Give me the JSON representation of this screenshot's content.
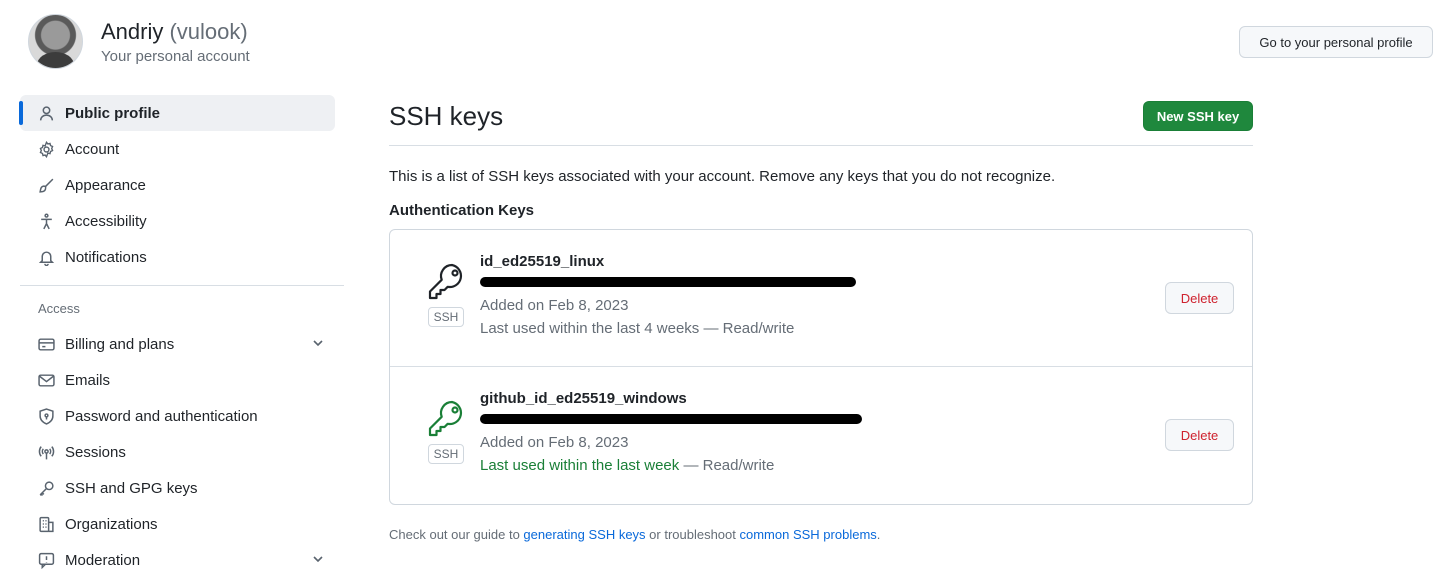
{
  "header": {
    "name": "Andriy",
    "handle": "(vulook)",
    "account_type": "Your personal account",
    "profile_button": "Go to your personal profile"
  },
  "sidebar": {
    "top_items": [
      {
        "label": "Public profile",
        "icon": "person-icon",
        "active": true
      },
      {
        "label": "Account",
        "icon": "gear-icon"
      },
      {
        "label": "Appearance",
        "icon": "paintbrush-icon"
      },
      {
        "label": "Accessibility",
        "icon": "accessibility-icon"
      },
      {
        "label": "Notifications",
        "icon": "bell-icon"
      }
    ],
    "access_label": "Access",
    "access_items": [
      {
        "label": "Billing and plans",
        "icon": "credit-card-icon",
        "expandable": true
      },
      {
        "label": "Emails",
        "icon": "mail-icon"
      },
      {
        "label": "Password and authentication",
        "icon": "shield-lock-icon"
      },
      {
        "label": "Sessions",
        "icon": "broadcast-icon"
      },
      {
        "label": "SSH and GPG keys",
        "icon": "key-icon"
      },
      {
        "label": "Organizations",
        "icon": "organization-icon"
      },
      {
        "label": "Moderation",
        "icon": "report-icon",
        "expandable": true
      }
    ]
  },
  "main": {
    "title": "SSH keys",
    "new_key_button": "New SSH key",
    "intro": "This is a list of SSH keys associated with your account. Remove any keys that you do not recognize.",
    "section_heading": "Authentication Keys",
    "keys": [
      {
        "title": "id_ed25519_linux",
        "badge": "SSH",
        "added": "Added on Feb 8, 2023",
        "last_used": "Last used within the last 4 weeks",
        "access": " — Read/write",
        "recent": false,
        "icon_color": "#1f2328",
        "delete_label": "Delete"
      },
      {
        "title": "github_id_ed25519_windows",
        "badge": "SSH",
        "added": "Added on Feb 8, 2023",
        "last_used": "Last used within the last week",
        "access": " — Read/write",
        "recent": true,
        "icon_color": "#1a7f37",
        "delete_label": "Delete"
      }
    ],
    "footer": {
      "prefix": "Check out our guide to ",
      "link1": "generating SSH keys",
      "middle": " or troubleshoot ",
      "link2": "common SSH problems",
      "suffix": "."
    }
  },
  "colors": {
    "accent": "#0969da",
    "primary_button": "#1f883d",
    "danger": "#cf222e",
    "success": "#1a7f37"
  }
}
